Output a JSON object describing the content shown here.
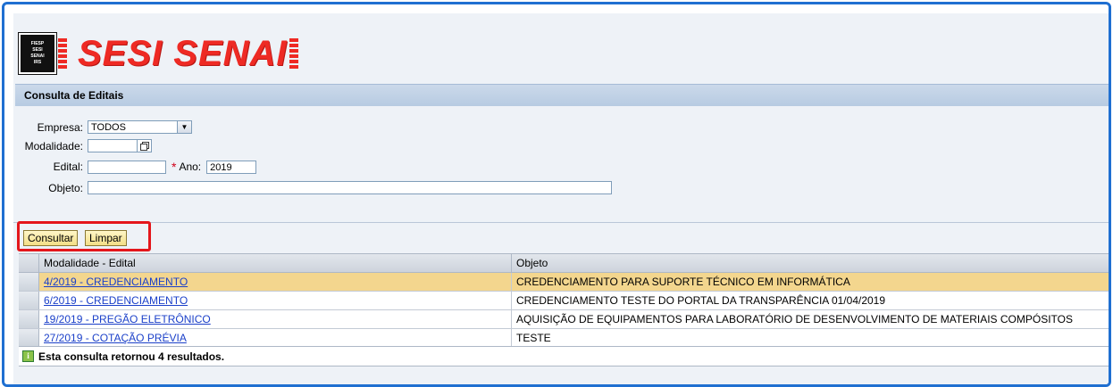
{
  "logo": {
    "box_lines": [
      "FIESP",
      "SESI",
      "SENAI",
      "IRS"
    ],
    "text": "SESI SENAI"
  },
  "title": "Consulta de Editais",
  "form": {
    "empresa_label": "Empresa:",
    "empresa_value": "TODOS",
    "modalidade_label": "Modalidade:",
    "modalidade_value": "",
    "edital_label": "Edital:",
    "edital_value": "",
    "ano_label": "Ano:",
    "ano_value": "2019",
    "objeto_label": "Objeto:",
    "objeto_value": ""
  },
  "buttons": {
    "consultar": "Consultar",
    "limpar": "Limpar"
  },
  "table": {
    "headers": [
      "Modalidade - Edital",
      "Objeto"
    ],
    "rows": [
      {
        "edital": "4/2019 - CREDENCIAMENTO",
        "objeto": "CREDENCIAMENTO PARA SUPORTE TÉCNICO EM INFORMÁTICA"
      },
      {
        "edital": "6/2019 - CREDENCIAMENTO",
        "objeto": "CREDENCIAMENTO TESTE DO PORTAL DA TRANSPARÊNCIA 01/04/2019"
      },
      {
        "edital": "19/2019 - PREGÃO ELETRÔNICO",
        "objeto": "AQUISIÇÃO DE EQUIPAMENTOS PARA LABORATÓRIO DE DESENVOLVIMENTO DE MATERIAIS COMPÓSITOS"
      },
      {
        "edital": "27/2019 - COTAÇÃO PRÉVIA",
        "objeto": "TESTE"
      }
    ]
  },
  "status": {
    "icon": "info-icon",
    "message": "Esta consulta retornou 4 resultados."
  },
  "colors": {
    "brand_red": "#ee2a24",
    "highlight_row": "#f3d68e",
    "link": "#1b40c9",
    "frame": "#1f6fd1"
  }
}
